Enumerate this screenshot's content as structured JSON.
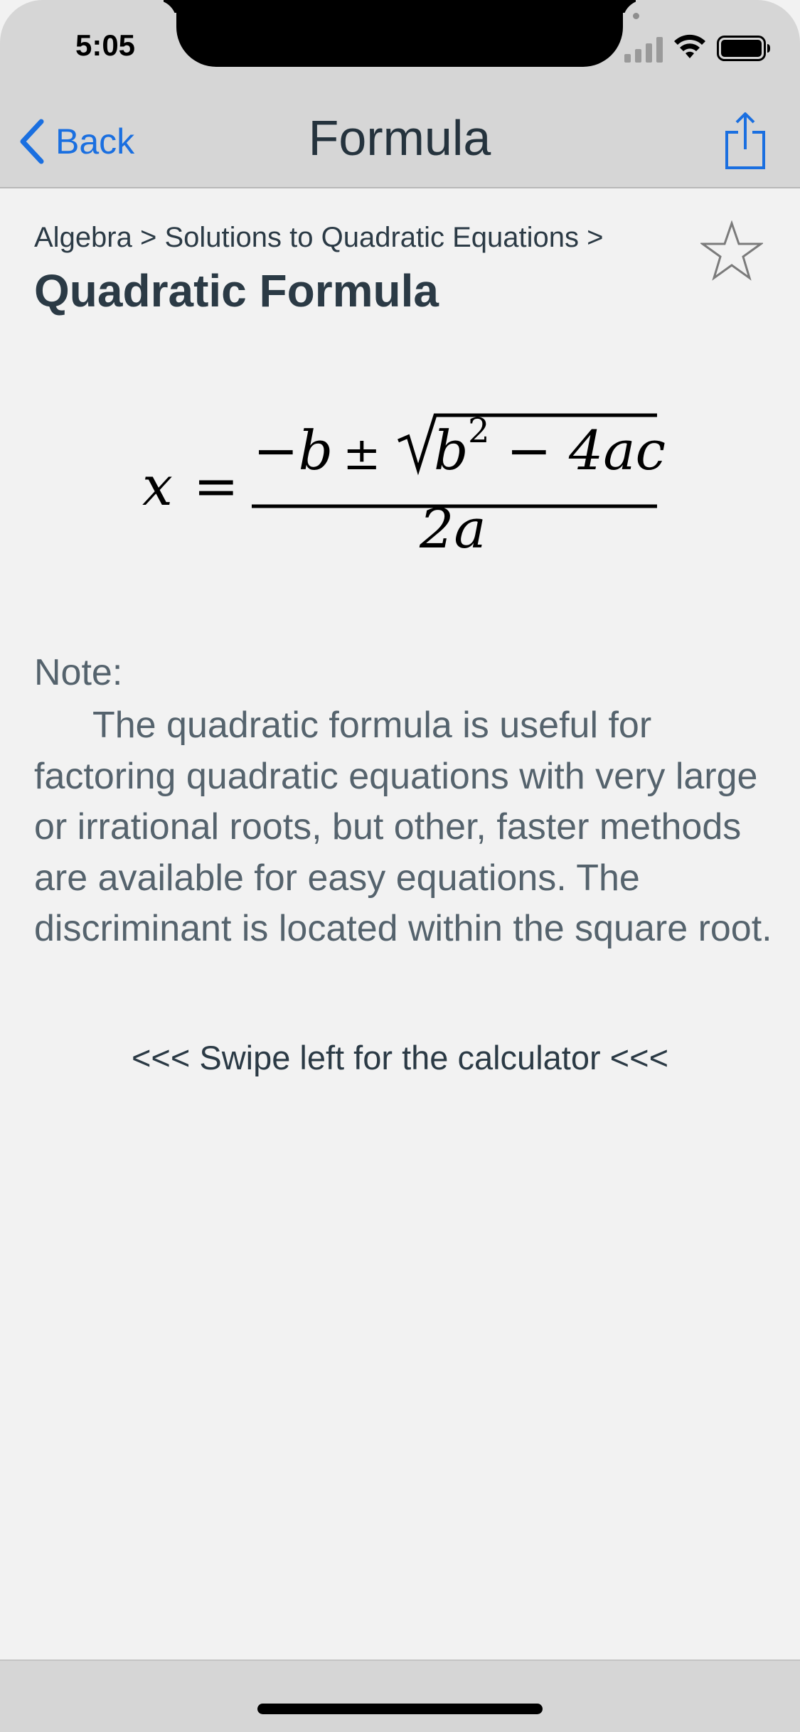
{
  "status_bar": {
    "time": "5:05",
    "signal_icon": "cellular-signal-icon",
    "wifi_icon": "wifi-icon",
    "battery_icon": "battery-icon"
  },
  "nav": {
    "back_label": "Back",
    "title": "Formula",
    "share_icon": "share-icon",
    "accent_color": "#1a6fe0"
  },
  "content": {
    "breadcrumb": "Algebra > Solutions to Quadratic Equations >",
    "title": "Quadratic Formula",
    "favorite_icon": "star-outline-icon",
    "formula": {
      "lhs": "x",
      "equals": "=",
      "minus_b": "−b",
      "plus_minus": "±",
      "radicand_b": "b",
      "exponent": "2",
      "radicand_rest": "− 4ac",
      "denominator": "2a"
    },
    "note_label": "Note:",
    "note_text": "The quadratic formula is useful for factoring quadratic equations with very large or irrational roots, but other, faster methods are available for easy equations. The discriminant is located within the square root.",
    "swipe_hint": "<<< Swipe left for the calculator <<<"
  }
}
